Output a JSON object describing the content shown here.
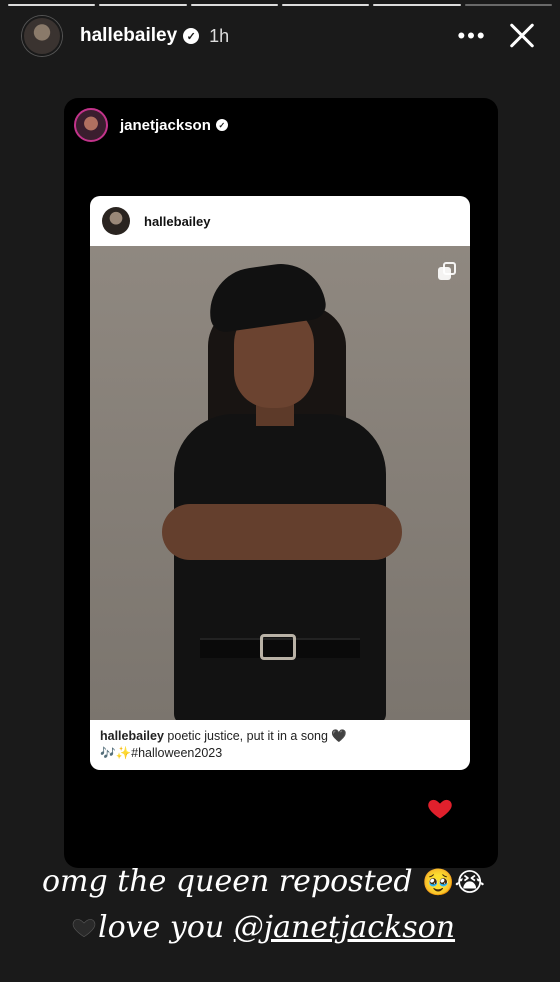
{
  "story": {
    "progress_total": 6,
    "progress_active": 5,
    "header": {
      "username": "hallebailey",
      "verified": true,
      "time": "1h",
      "more_label": "•••",
      "icons": {
        "more": "more-horizontal-icon",
        "close": "close-icon",
        "verified": "verified-badge-icon"
      }
    },
    "repost": {
      "username": "janetjackson",
      "verified": true,
      "post": {
        "username": "hallebailey",
        "caption_user": "hallebailey",
        "caption_text": " poetic justice, put it in a song 🖤",
        "caption_text2": "🎶✨#halloween2023",
        "icons": {
          "multi": "multiple-images-icon"
        }
      }
    },
    "reaction": {
      "icon": "heart-icon",
      "color": "#e0202c"
    },
    "caption": {
      "line1_text": "omg the queen reposted ",
      "line1_emoji": "🥹😭",
      "line2_text": "love you ",
      "line2_mention": "@janetjackson"
    }
  }
}
